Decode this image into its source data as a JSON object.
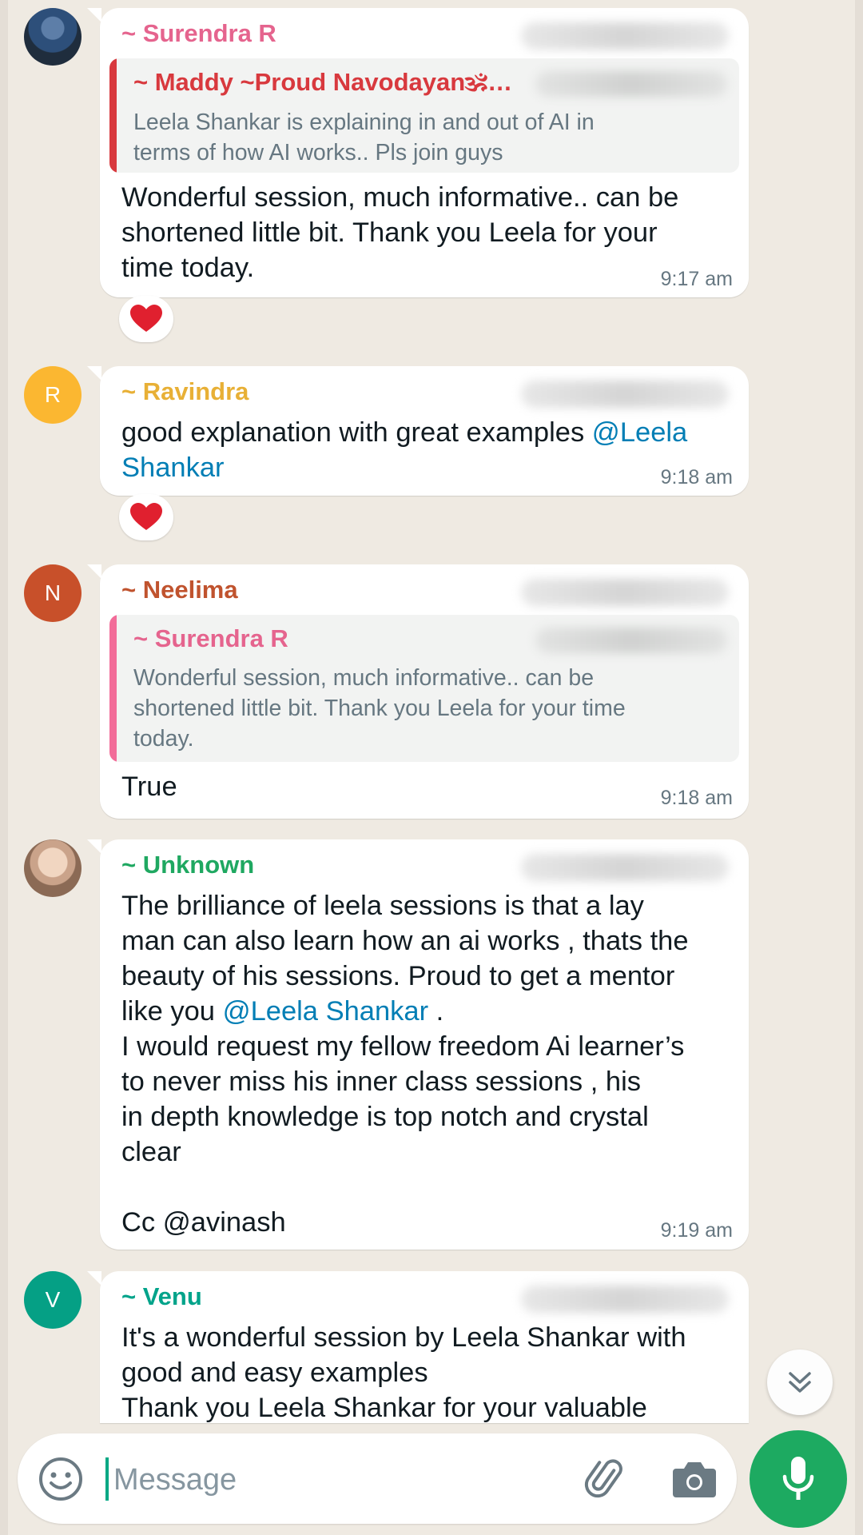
{
  "colors": {
    "accent": "#1daa61",
    "mention": "#027eb5",
    "surendra": "#e5648e",
    "maddy": "#d8393e",
    "ravindra": "#e8b036",
    "neelima": "#c0532e",
    "unknown": "#1fa861",
    "venu": "#00a38a"
  },
  "messages": [
    {
      "sender": "~ Surendra R",
      "quote": {
        "sender": "~ Maddy ~Proud Navodayan🕉…",
        "text": "Leela Shankar is explaining in and out of AI in\nterms of how AI works.. Pls join guys"
      },
      "text": "Wonderful session, much informative.. can be\nshortened little bit. Thank you Leela for your\ntime today.",
      "time": "9:17 am",
      "reaction": "heart"
    },
    {
      "sender": "~ Ravindra",
      "avatar_letter": "R",
      "text_before_mention": "good explanation with great examples ",
      "mention": "@Leela\nShankar",
      "time": "9:18 am",
      "reaction": "heart"
    },
    {
      "sender": "~ Neelima",
      "avatar_letter": "N",
      "quote": {
        "sender": "~ Surendra R",
        "text": "Wonderful session, much informative.. can be\nshortened little bit. Thank you Leela for your time\ntoday."
      },
      "text": "True",
      "time": "9:18 am"
    },
    {
      "sender": "~ Unknown",
      "text_part1": "The brilliance of leela sessions is that a lay\nman can also learn how an ai works , thats the\nbeauty of his sessions. Proud to get a mentor\nlike you ",
      "mention": "@Leela Shankar",
      "text_part2": "  .\nI would request my fellow freedom Ai learner’s\nto never miss his inner class sessions , his\nin depth knowledge is top notch and crystal\nclear\n\nCc @avinash",
      "time": "9:19 am"
    },
    {
      "sender": "~ Venu",
      "avatar_letter": "V",
      "text": "It's a wonderful session by Leela Shankar with\ngood and easy examples\nThank you Leela Shankar for your valuable"
    }
  ],
  "composer": {
    "placeholder": "Message",
    "icons": [
      "emoji-icon",
      "attach-icon",
      "camera-icon",
      "mic-icon"
    ]
  },
  "scroll_button_icon": "double-chevron-down-icon"
}
